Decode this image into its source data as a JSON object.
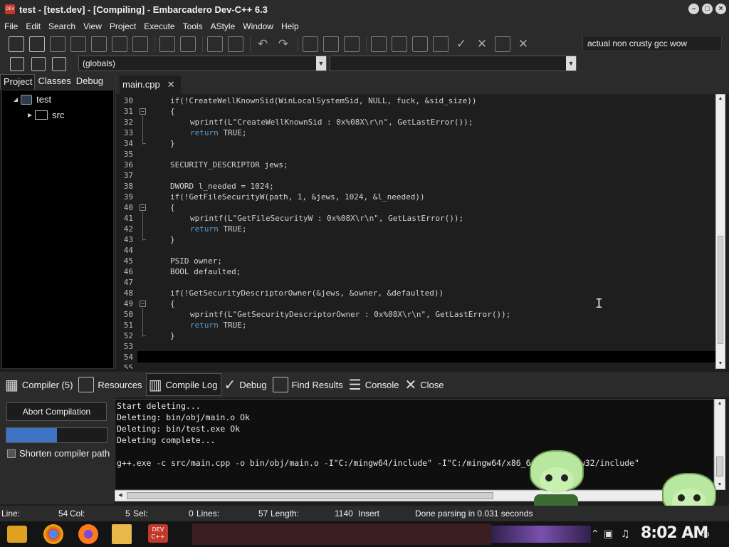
{
  "window": {
    "title": "test - [test.dev] - [Compiling] - Embarcadero Dev-C++ 6.3",
    "icon_text": "DEV"
  },
  "menu": [
    "File",
    "Edit",
    "Search",
    "View",
    "Project",
    "Execute",
    "Tools",
    "AStyle",
    "Window",
    "Help"
  ],
  "toolbar": {
    "compiler_set": "actual non crusty gcc wow"
  },
  "toolbar2": {
    "scope_combo": "(globals)",
    "function_combo": ""
  },
  "left_panel": {
    "tabs": [
      "Project",
      "Classes",
      "Debug"
    ],
    "active_tab": "Project",
    "tree": [
      {
        "label": "test",
        "icon": "project-icon"
      },
      {
        "label": "src",
        "icon": "folder-icon"
      }
    ]
  },
  "editor": {
    "tab_label": "main.cpp",
    "lines": [
      {
        "n": "30",
        "indent": 1,
        "parts": [
          [
            "",
            "if(!CreateWellKnownSid(WinLocalSystemSid, NULL, fuck, &sid_size))"
          ]
        ]
      },
      {
        "n": "31",
        "indent": 1,
        "parts": [
          [
            "",
            "{"
          ]
        ]
      },
      {
        "n": "32",
        "indent": 2,
        "parts": [
          [
            "",
            "wprintf(L"
          ],
          [
            "str",
            "\"CreateWellKnownSid : 0x%08X\\r\\n\""
          ],
          [
            "",
            ", GetLastError());"
          ]
        ]
      },
      {
        "n": "33",
        "indent": 2,
        "parts": [
          [
            "kw",
            "return"
          ],
          [
            "",
            " TRUE;"
          ]
        ]
      },
      {
        "n": "34",
        "indent": 1,
        "parts": [
          [
            "",
            "}"
          ]
        ]
      },
      {
        "n": "35",
        "indent": 0,
        "parts": []
      },
      {
        "n": "36",
        "indent": 1,
        "parts": [
          [
            "",
            "SECURITY_DESCRIPTOR jews;"
          ]
        ]
      },
      {
        "n": "37",
        "indent": 0,
        "parts": []
      },
      {
        "n": "38",
        "indent": 1,
        "parts": [
          [
            "",
            "DWORD l_needed = 1024;"
          ]
        ]
      },
      {
        "n": "39",
        "indent": 1,
        "parts": [
          [
            "",
            "if(!GetFileSecurityW(path, 1, &jews, 1024, &l_needed))"
          ]
        ]
      },
      {
        "n": "40",
        "indent": 1,
        "parts": [
          [
            "",
            "{"
          ]
        ]
      },
      {
        "n": "41",
        "indent": 2,
        "parts": [
          [
            "",
            "wprintf(L"
          ],
          [
            "str",
            "\"GetFileSecurityW : 0x%08X\\r\\n\""
          ],
          [
            "",
            ", GetLastError());"
          ]
        ]
      },
      {
        "n": "42",
        "indent": 2,
        "parts": [
          [
            "kw",
            "return"
          ],
          [
            "",
            " TRUE;"
          ]
        ]
      },
      {
        "n": "43",
        "indent": 1,
        "parts": [
          [
            "",
            "}"
          ]
        ]
      },
      {
        "n": "44",
        "indent": 0,
        "parts": []
      },
      {
        "n": "45",
        "indent": 1,
        "parts": [
          [
            "",
            "PSID owner;"
          ]
        ]
      },
      {
        "n": "46",
        "indent": 1,
        "parts": [
          [
            "",
            "BOOL defaulted;"
          ]
        ]
      },
      {
        "n": "47",
        "indent": 0,
        "parts": []
      },
      {
        "n": "48",
        "indent": 1,
        "parts": [
          [
            "",
            "if(!GetSecurityDescriptorOwner(&jews, &owner, &defaulted))"
          ]
        ]
      },
      {
        "n": "49",
        "indent": 1,
        "parts": [
          [
            "",
            "{"
          ]
        ]
      },
      {
        "n": "50",
        "indent": 2,
        "parts": [
          [
            "",
            "wprintf(L"
          ],
          [
            "str",
            "\"GetSecurityDescriptorOwner : 0x%08X\\r\\n\""
          ],
          [
            "",
            ", GetLastError());"
          ]
        ]
      },
      {
        "n": "51",
        "indent": 2,
        "parts": [
          [
            "kw",
            "return"
          ],
          [
            "",
            " TRUE;"
          ]
        ]
      },
      {
        "n": "52",
        "indent": 1,
        "parts": [
          [
            "",
            "}"
          ]
        ]
      },
      {
        "n": "53",
        "indent": 0,
        "parts": []
      },
      {
        "n": "54",
        "indent": 0,
        "parts": []
      },
      {
        "n": "55",
        "indent": 0,
        "parts": []
      }
    ],
    "fold_lines": [
      "31",
      "40",
      "49"
    ]
  },
  "bottom_tabs": [
    {
      "label": "Compiler (5)",
      "icon": "grid-icon"
    },
    {
      "label": "Resources",
      "icon": "resources-icon"
    },
    {
      "label": "Compile Log",
      "icon": "bar-chart-icon",
      "active": true
    },
    {
      "label": "Debug",
      "icon": "check-icon"
    },
    {
      "label": "Find Results",
      "icon": "search-icon"
    },
    {
      "label": "Console",
      "icon": "console-icon"
    },
    {
      "label": "Close",
      "icon": "close-icon"
    }
  ],
  "compile": {
    "abort_label": "Abort Compilation",
    "progress_fraction": 0.5,
    "shorten_label": "Shorten compiler path",
    "log": [
      "Start deleting...",
      "Deleting: bin/obj/main.o Ok",
      "Deleting: bin/test.exe Ok",
      "Deleting complete...",
      "",
      "g++.exe -c src/main.cpp -o bin/obj/main.o -I\"C:/mingw64/include\" -I\"C:/mingw64/x86_64-w64-mingw32/include\""
    ]
  },
  "status": {
    "line_label": "Line:",
    "line_value": "54",
    "col_label": "Col:",
    "col_value": "5",
    "sel_label": "Sel:",
    "sel_value": "0",
    "lines_label": "Lines:",
    "lines_value": "57",
    "length_label": "Length:",
    "length_value": "1140",
    "mode": "Insert",
    "parse_msg": "Done parsing in 0.031 seconds"
  },
  "taskbar": {
    "clock": "8:02 AM",
    "dev_text_1": "DEV",
    "dev_text_2": "C++"
  },
  "colors": {
    "accent": "#3f74c4",
    "keyword": "#569cd6"
  }
}
